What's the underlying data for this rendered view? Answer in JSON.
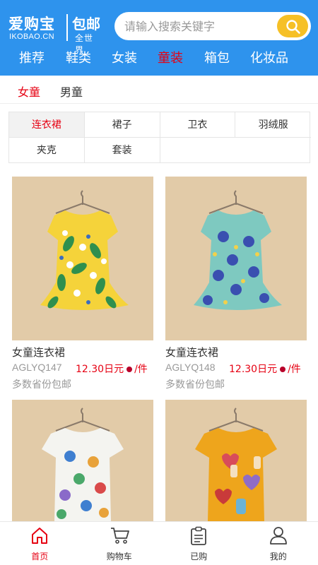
{
  "header": {
    "brand": "爱购宝",
    "domain": "IKOBAO.CN",
    "free_shipping": "包邮",
    "worldwide": "全世界",
    "search_placeholder": "请输入搜索关键字"
  },
  "nav": {
    "items": [
      {
        "label": "推荐"
      },
      {
        "label": "鞋类"
      },
      {
        "label": "女装"
      },
      {
        "label": "童装"
      },
      {
        "label": "箱包"
      },
      {
        "label": "化妆品"
      }
    ],
    "active": "童装"
  },
  "subtabs": {
    "items": [
      {
        "label": "女童"
      },
      {
        "label": "男童"
      }
    ],
    "active": "女童"
  },
  "categories": {
    "items": [
      {
        "label": "连衣裙"
      },
      {
        "label": "裙子"
      },
      {
        "label": "卫衣"
      },
      {
        "label": "羽绒服"
      },
      {
        "label": "夹克"
      },
      {
        "label": "套装"
      }
    ],
    "active": "连衣裙"
  },
  "products": [
    {
      "name": "女童连衣裙",
      "code": "AGLYQ147",
      "price": "12.30日元",
      "unit": "/件",
      "shipping": "多数省份包邮"
    },
    {
      "name": "女童连衣裙",
      "code": "AGLYQ148",
      "price": "12.30日元",
      "unit": "/件",
      "shipping": "多数省份包邮"
    },
    {
      "name": "",
      "code": "",
      "price": "",
      "unit": "",
      "shipping": ""
    },
    {
      "name": "",
      "code": "",
      "price": "",
      "unit": "",
      "shipping": ""
    }
  ],
  "tabbar": {
    "items": [
      {
        "label": "首页",
        "icon": "home-icon"
      },
      {
        "label": "购物车",
        "icon": "cart-icon"
      },
      {
        "label": "已购",
        "icon": "clipboard-icon"
      },
      {
        "label": "我的",
        "icon": "user-icon"
      }
    ],
    "active": "首页"
  },
  "colors": {
    "header_bg": "#2e93ed",
    "accent_red": "#e60012",
    "search_button": "#f6c026"
  }
}
